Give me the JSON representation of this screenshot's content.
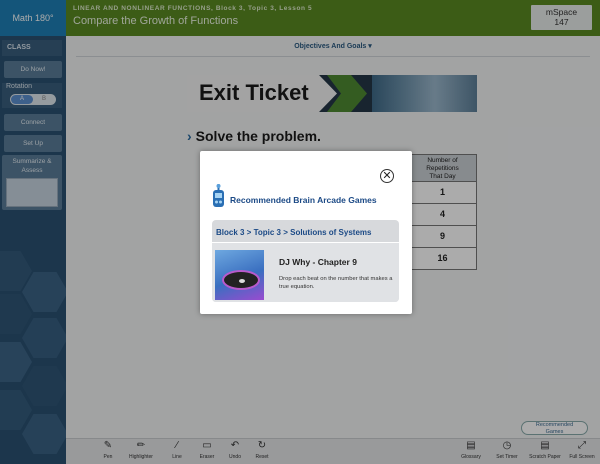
{
  "header": {
    "logo": "Math 180°",
    "lesson_subtitle": "LINEAR AND NONLINEAR FUNCTIONS, Block 3, Topic 3, Lesson 5",
    "lesson_title": "Compare the Growth of Functions",
    "mspace_label": "mSpace",
    "mspace_count": "147"
  },
  "sidebar": {
    "class_label": "CLASS",
    "do_now": "Do Now!",
    "rotation_label": "Rotation",
    "rotation_a": "A",
    "rotation_b": "B",
    "connect": "Connect",
    "set_up": "Set Up",
    "summarize_line1": "Summarize &",
    "summarize_line2": "Assess"
  },
  "content": {
    "objectives_label": "Objectives And Goals",
    "banner_text": "Exit Ticket",
    "prompt": "Solve the problem.",
    "table_header_line1": "Number of",
    "table_header_line2": "Repetitions",
    "table_header_line3": "That Day",
    "table_values": [
      "1",
      "4",
      "9",
      "16"
    ],
    "recommended_line1": "Recommended",
    "recommended_line2": "Games"
  },
  "modal": {
    "title": "Recommended Brain Arcade Games",
    "breadcrumb": "Block 3 > Topic 3 > Solutions of Systems",
    "game_title": "DJ Why - Chapter 9",
    "game_description": "Drop each beat on the number that makes a true equation."
  },
  "toolbar": {
    "tools": [
      "Pen",
      "Highlighter",
      "Line",
      "Eraser",
      "Undo",
      "Reset"
    ],
    "right_tools": [
      "Glossary",
      "Set Timer",
      "Scratch Paper",
      "Full Screen"
    ]
  },
  "colors": {
    "header_green": "#5a8a22",
    "logo_blue": "#1f7fb6",
    "sidebar_blue": "#2b5172",
    "modal_title_blue": "#1c4a86"
  }
}
